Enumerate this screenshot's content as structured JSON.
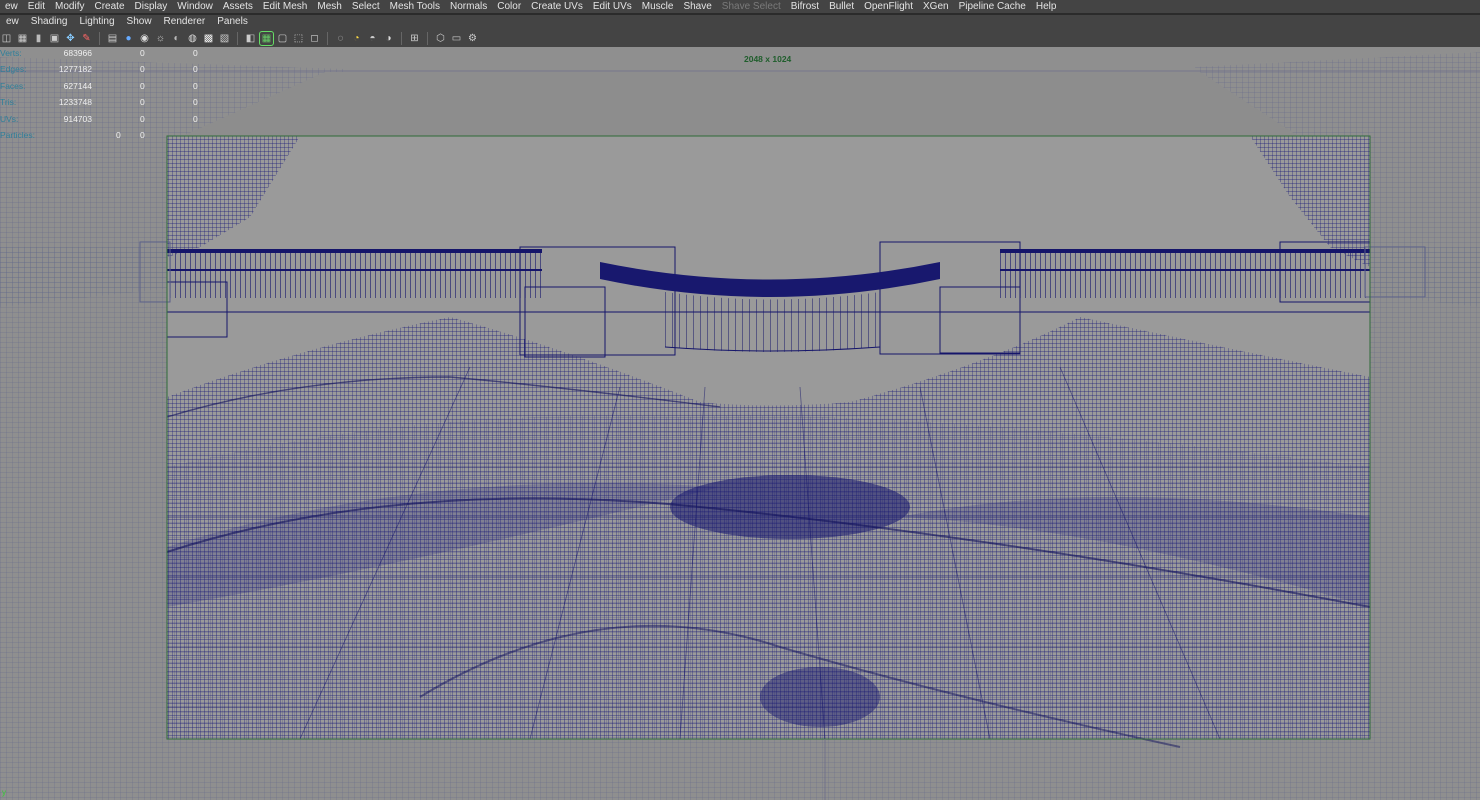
{
  "menubar": {
    "items": [
      "ew",
      "Edit",
      "Modify",
      "Create",
      "Display",
      "Window",
      "Assets",
      "Edit Mesh",
      "Mesh",
      "Select",
      "Mesh Tools",
      "Normals",
      "Color",
      "Create UVs",
      "Edit UVs",
      "Muscle",
      "Shave",
      "Shave Select",
      "Bifrost",
      "Bullet",
      "OpenFlight",
      "XGen",
      "Pipeline Cache",
      "Help"
    ],
    "disabled_item": "Shave Select"
  },
  "panel_menu": {
    "items": [
      "ew",
      "Shading",
      "Lighting",
      "Show",
      "Renderer",
      "Panels"
    ]
  },
  "toolbar": {
    "icons": [
      "camera-icon",
      "grid-icon",
      "bookmark-icon",
      "image-plane-icon",
      "two-d-pan-icon",
      "grease-pencil-icon",
      "separator",
      "wireframe-icon",
      "smooth-shade-icon",
      "texture-icon",
      "lights-icon",
      "shadows-icon",
      "ambient-occlusion-icon",
      "anti-alias-icon",
      "texture-checker-icon",
      "separator",
      "isolate-select-icon",
      "resolution-gate-icon",
      "gate-mask-icon",
      "safe-action-icon",
      "xray-icon",
      "separator",
      "ssao-icon",
      "motion-blur-icon",
      "depth-of-field-icon",
      "exposure-icon",
      "separator",
      "xray-joints-icon",
      "separator",
      "viewport-2-icon",
      "film-gate-icon",
      "camera-attributes-icon"
    ]
  },
  "hud": {
    "rows": [
      {
        "label": "Verts:",
        "value": "683966",
        "sel": "0",
        "comp": "0"
      },
      {
        "label": "Edges:",
        "value": "1277182",
        "sel": "0",
        "comp": "0"
      },
      {
        "label": "Faces:",
        "value": "627144",
        "sel": "0",
        "comp": "0"
      },
      {
        "label": "Tris:",
        "value": "1233748",
        "sel": "0",
        "comp": "0"
      },
      {
        "label": "UVs:",
        "value": "914703",
        "sel": "0",
        "comp": "0"
      }
    ],
    "particles_label": "Particles:",
    "particles_value": "0",
    "particles_sel": "0",
    "resolution_gate": "2048 x 1024"
  },
  "viewport": {
    "background_color": "#8b8b8b",
    "wire_color": "#1a1a78",
    "gate_border_color": "#2e6b38"
  }
}
